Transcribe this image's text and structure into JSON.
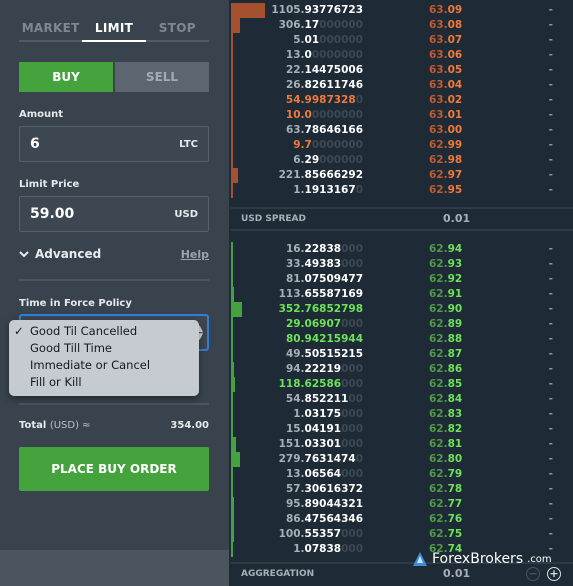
{
  "order_form": {
    "tabs": [
      {
        "label": "MARKET",
        "active": false
      },
      {
        "label": "LIMIT",
        "active": true
      },
      {
        "label": "STOP",
        "active": false
      }
    ],
    "side": {
      "buy_label": "BUY",
      "sell_label": "SELL",
      "selected": "BUY"
    },
    "amount": {
      "label": "Amount",
      "value": "6",
      "unit": "LTC"
    },
    "limit_price": {
      "label": "Limit Price",
      "value": "59.00",
      "unit": "USD"
    },
    "advanced": {
      "label": "Advanced",
      "help_label": "Help",
      "expand_icon": "chevron-down-icon"
    },
    "time_in_force": {
      "label": "Time in Force Policy",
      "selected": "Good Til Cancelled",
      "options": [
        {
          "label": "Good Til Cancelled",
          "checked": true
        },
        {
          "label": "Good Till Time",
          "checked": false
        },
        {
          "label": "Immediate or Cancel",
          "checked": false
        },
        {
          "label": "Fill or Kill",
          "checked": false
        }
      ]
    },
    "total": {
      "label": "Total",
      "currency": "(USD) ≈",
      "value": "354.00"
    },
    "place_order_label": "PLACE BUY ORDER"
  },
  "order_book": {
    "colors": {
      "ask": "#f07a3e",
      "ask_bar": "#a5502f",
      "bid": "#6de25a",
      "bid_bar": "#44a33c"
    },
    "asks": [
      {
        "pre": "1105.",
        "sig": "93776723",
        "pad": "",
        "price_int": "63.",
        "price_dec": "09",
        "highlight": false,
        "depth": 1105.94
      },
      {
        "pre": "306.",
        "sig": "17",
        "pad": "000000",
        "price_int": "63.",
        "price_dec": "08",
        "highlight": false,
        "depth": 306.17
      },
      {
        "pre": "5.",
        "sig": "01",
        "pad": "000000",
        "price_int": "63.",
        "price_dec": "07",
        "highlight": false,
        "depth": 5.01
      },
      {
        "pre": "13.",
        "sig": "0",
        "pad": "0000000",
        "price_int": "63.",
        "price_dec": "06",
        "highlight": false,
        "depth": 13.0
      },
      {
        "pre": "22.",
        "sig": "14475006",
        "pad": "",
        "price_int": "63.",
        "price_dec": "05",
        "highlight": false,
        "depth": 22.14
      },
      {
        "pre": "26.",
        "sig": "82611746",
        "pad": "",
        "price_int": "63.",
        "price_dec": "04",
        "highlight": false,
        "depth": 26.83
      },
      {
        "pre": "54.",
        "sig": "9987328",
        "pad": "0",
        "price_int": "63.",
        "price_dec": "02",
        "highlight": true,
        "depth": 55.0
      },
      {
        "pre": "10.",
        "sig": "0",
        "pad": "0000000",
        "price_int": "63.",
        "price_dec": "01",
        "highlight": true,
        "depth": 10.0
      },
      {
        "pre": "63.",
        "sig": "78646166",
        "pad": "",
        "price_int": "63.",
        "price_dec": "00",
        "highlight": false,
        "depth": 63.79
      },
      {
        "pre": "9.",
        "sig": "7",
        "pad": "0000000",
        "price_int": "62.",
        "price_dec": "99",
        "highlight": true,
        "depth": 9.7
      },
      {
        "pre": "6.",
        "sig": "29",
        "pad": "000000",
        "price_int": "62.",
        "price_dec": "98",
        "highlight": false,
        "depth": 6.29
      },
      {
        "pre": "221.",
        "sig": "85666292",
        "pad": "",
        "price_int": "62.",
        "price_dec": "97",
        "highlight": false,
        "depth": 221.86
      },
      {
        "pre": "1.",
        "sig": "1913167",
        "pad": "0",
        "price_int": "62.",
        "price_dec": "95",
        "highlight": false,
        "depth": 1.19
      }
    ],
    "spread": {
      "label": "USD SPREAD",
      "value": "0.01"
    },
    "bids": [
      {
        "pre": "16.",
        "sig": "22838",
        "pad": "000",
        "price_int": "62.",
        "price_dec": "94",
        "highlight": false,
        "depth": 16.23
      },
      {
        "pre": "33.",
        "sig": "49383",
        "pad": "000",
        "price_int": "62.",
        "price_dec": "93",
        "highlight": false,
        "depth": 33.49
      },
      {
        "pre": "81.",
        "sig": "07509477",
        "pad": "",
        "price_int": "62.",
        "price_dec": "92",
        "highlight": false,
        "depth": 81.08
      },
      {
        "pre": "113.",
        "sig": "65587169",
        "pad": "",
        "price_int": "62.",
        "price_dec": "91",
        "highlight": false,
        "depth": 113.66
      },
      {
        "pre": "352.",
        "sig": "76852798",
        "pad": "",
        "price_int": "62.",
        "price_dec": "90",
        "highlight": true,
        "depth": 352.77
      },
      {
        "pre": "29.",
        "sig": "06907",
        "pad": "000",
        "price_int": "62.",
        "price_dec": "89",
        "highlight": true,
        "depth": 29.07
      },
      {
        "pre": "80.",
        "sig": "94215944",
        "pad": "",
        "price_int": "62.",
        "price_dec": "88",
        "highlight": true,
        "depth": 80.94
      },
      {
        "pre": "49.",
        "sig": "50515215",
        "pad": "",
        "price_int": "62.",
        "price_dec": "87",
        "highlight": false,
        "depth": 49.51
      },
      {
        "pre": "94.",
        "sig": "22219",
        "pad": "000",
        "price_int": "62.",
        "price_dec": "86",
        "highlight": false,
        "depth": 94.22
      },
      {
        "pre": "118.",
        "sig": "62586",
        "pad": "000",
        "price_int": "62.",
        "price_dec": "85",
        "highlight": true,
        "depth": 118.63
      },
      {
        "pre": "54.",
        "sig": "852211",
        "pad": "00",
        "price_int": "62.",
        "price_dec": "84",
        "highlight": false,
        "depth": 54.85
      },
      {
        "pre": "1.",
        "sig": "03175",
        "pad": "000",
        "price_int": "62.",
        "price_dec": "83",
        "highlight": false,
        "depth": 1.03
      },
      {
        "pre": "15.",
        "sig": "04191",
        "pad": "000",
        "price_int": "62.",
        "price_dec": "82",
        "highlight": false,
        "depth": 15.04
      },
      {
        "pre": "151.",
        "sig": "03301",
        "pad": "000",
        "price_int": "62.",
        "price_dec": "81",
        "highlight": false,
        "depth": 151.03
      },
      {
        "pre": "279.",
        "sig": "7631474",
        "pad": "0",
        "price_int": "62.",
        "price_dec": "80",
        "highlight": false,
        "depth": 279.76
      },
      {
        "pre": "13.",
        "sig": "06564",
        "pad": "000",
        "price_int": "62.",
        "price_dec": "79",
        "highlight": false,
        "depth": 13.07
      },
      {
        "pre": "57.",
        "sig": "30616372",
        "pad": "",
        "price_int": "62.",
        "price_dec": "78",
        "highlight": false,
        "depth": 57.31
      },
      {
        "pre": "95.",
        "sig": "89044321",
        "pad": "",
        "price_int": "62.",
        "price_dec": "77",
        "highlight": false,
        "depth": 95.89
      },
      {
        "pre": "86.",
        "sig": "47564346",
        "pad": "",
        "price_int": "62.",
        "price_dec": "76",
        "highlight": false,
        "depth": 86.48
      },
      {
        "pre": "100.",
        "sig": "55357",
        "pad": "000",
        "price_int": "62.",
        "price_dec": "75",
        "highlight": false,
        "depth": 100.55
      },
      {
        "pre": "1.",
        "sig": "07838",
        "pad": "000",
        "price_int": "62.",
        "price_dec": "74",
        "highlight": false,
        "depth": 1.08
      }
    ],
    "my_size_placeholder": "-",
    "aggregation": {
      "label": "AGGREGATION",
      "value": "0.01",
      "decrease_icon": "minus-circle-icon",
      "increase_icon": "plus-circle-icon"
    }
  },
  "watermark": {
    "brand": "ForexBrokers",
    "suffix": ".com"
  }
}
